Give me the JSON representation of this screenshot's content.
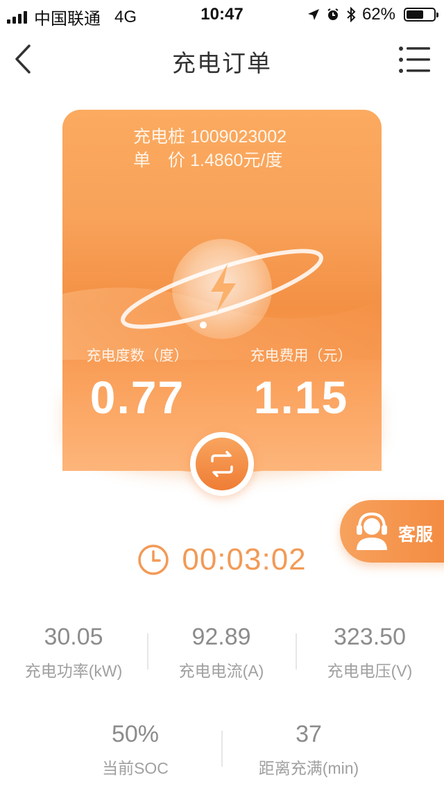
{
  "status_bar": {
    "carrier": "中国联通",
    "network": "4G",
    "time": "10:47",
    "battery": "62%",
    "battery_level": 0.62
  },
  "nav": {
    "title": "充电订单"
  },
  "card": {
    "pile_label": "充电桩",
    "pile_id": "1009023002",
    "price_label": "单　价",
    "price_value": "1.4860元/度",
    "energy_label": "充电度数（度）",
    "energy_value": "0.77",
    "cost_label": "充电费用（元）",
    "cost_value": "1.15"
  },
  "customer_service": {
    "label": "客服"
  },
  "timer": {
    "value": "00:03:02"
  },
  "stats": {
    "power": {
      "value": "30.05",
      "label": "充电功率(kW)"
    },
    "current": {
      "value": "92.89",
      "label": "充电电流(A)"
    },
    "voltage": {
      "value": "323.50",
      "label": "充电电压(V)"
    },
    "soc": {
      "value": "50%",
      "label": "当前SOC"
    },
    "remaining": {
      "value": "37",
      "label": "距离充满(min)"
    }
  },
  "colors": {
    "accent": "#f29a56",
    "card_orange": "#f6a057",
    "text_gray": "#8c8c8c"
  }
}
